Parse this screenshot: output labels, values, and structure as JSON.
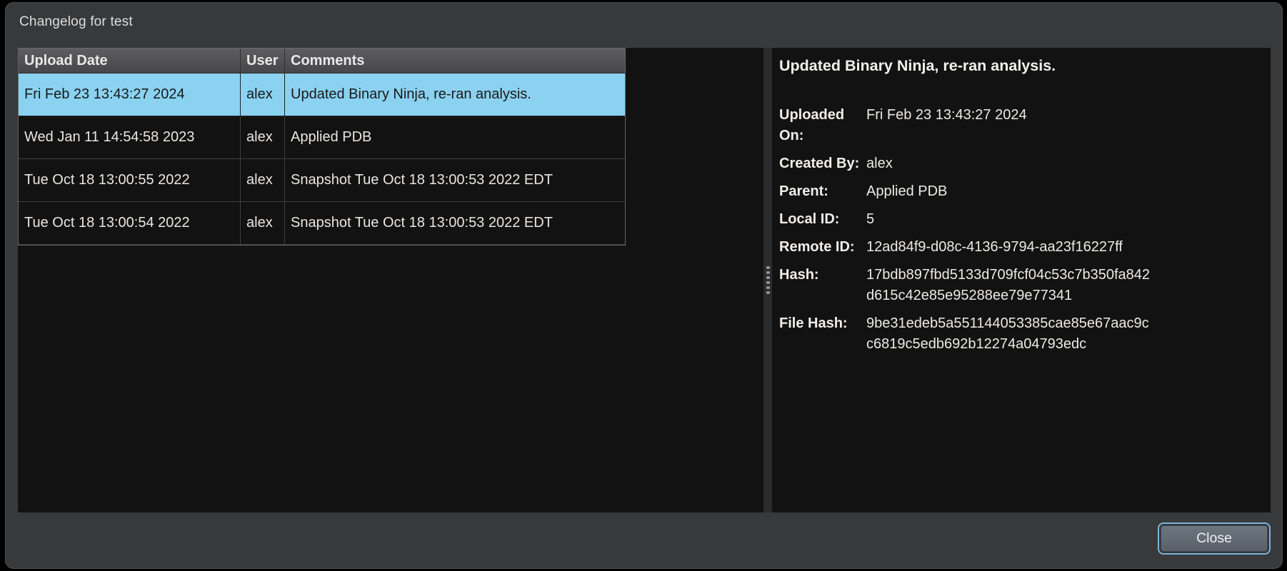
{
  "window": {
    "title": "Changelog for test",
    "colors": {
      "selection": "#8bd2f0",
      "focus_ring": "#7cb5d6",
      "panel_bg": "#121212",
      "frame": "#38393b"
    }
  },
  "table": {
    "columns": [
      "Upload Date",
      "User",
      "Comments"
    ],
    "rows": [
      {
        "upload_date": "Fri Feb 23 13:43:27 2024",
        "user": "alex",
        "comments": "Updated Binary Ninja, re-ran analysis.",
        "selected": true
      },
      {
        "upload_date": "Wed Jan 11 14:54:58 2023",
        "user": "alex",
        "comments": "Applied PDB",
        "selected": false
      },
      {
        "upload_date": "Tue Oct 18 13:00:55 2022",
        "user": "alex",
        "comments": "Snapshot Tue Oct 18 13:00:53 2022 EDT",
        "selected": false
      },
      {
        "upload_date": "Tue Oct 18 13:00:54 2022",
        "user": "alex",
        "comments": "Snapshot Tue Oct 18 13:00:53 2022 EDT",
        "selected": false
      }
    ]
  },
  "details": {
    "heading": "Updated Binary Ninja, re-ran analysis.",
    "fields": [
      {
        "label": "Uploaded On:",
        "value": "Fri Feb 23 13:43:27 2024"
      },
      {
        "label": "Created By:",
        "value": "alex"
      },
      {
        "label": "Parent:",
        "value": "Applied PDB"
      },
      {
        "label": "Local ID:",
        "value": "5"
      },
      {
        "label": "Remote ID:",
        "value": "12ad84f9-d08c-4136-9794-aa23f16227ff"
      },
      {
        "label": "Hash:",
        "value": "17bdb897fbd5133d709fcf04c53c7b350fa842d615c42e85e95288ee79e77341"
      },
      {
        "label": "File Hash:",
        "value": "9be31edeb5a551144053385cae85e67aac9cc6819c5edb692b12274a04793edc"
      }
    ]
  },
  "footer": {
    "close_label": "Close"
  }
}
